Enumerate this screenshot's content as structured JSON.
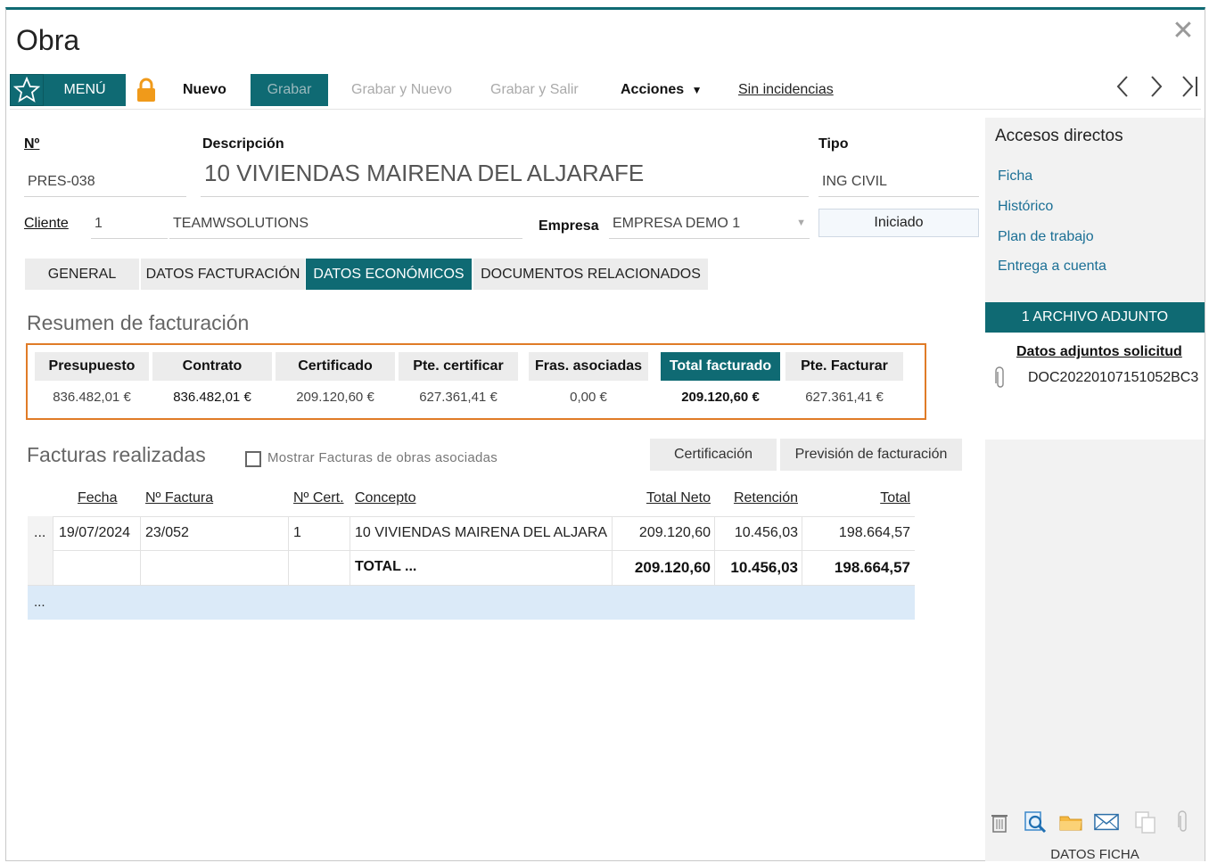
{
  "window": {
    "title": "Obra",
    "close_symbol": "✕"
  },
  "toolbar": {
    "menu_label": "MENÚ",
    "nuevo_label": "Nuevo",
    "grabar_label": "Grabar",
    "grabar_nuevo_label": "Grabar y Nuevo",
    "grabar_salir_label": "Grabar y Salir",
    "acciones_label": "Acciones",
    "incidencias_label": "Sin incidencias",
    "accent": "#0f6a73",
    "lock_color": "#f09a1a"
  },
  "header": {
    "numero_label": "Nº",
    "numero_value": "PRES-038",
    "descripcion_label": "Descripción",
    "descripcion_value": "10 VIVIENDAS MAIRENA DEL ALJARAFE",
    "tipo_label": "Tipo",
    "tipo_value": "ING CIVIL",
    "cliente_label": "Cliente",
    "cliente_code": "1",
    "cliente_name": "TEAMWSOLUTIONS",
    "empresa_label": "Empresa",
    "empresa_value": "EMPRESA DEMO 1",
    "estado_value": "Iniciado"
  },
  "tabs": [
    {
      "label": "GENERAL"
    },
    {
      "label": "DATOS FACTURACIÓN"
    },
    {
      "label": "DATOS ECONÓMICOS",
      "active": true
    },
    {
      "label": "DOCUMENTOS RELACIONADOS"
    }
  ],
  "resumen": {
    "title": "Resumen de facturación",
    "columns": [
      {
        "header": "Presupuesto",
        "value": "836.482,01 €"
      },
      {
        "header": "Contrato",
        "value": "836.482,01 €"
      },
      {
        "header": "Certificado",
        "value": "209.120,60 €"
      },
      {
        "header": "Pte. certificar",
        "value": "627.361,41 €"
      },
      {
        "header": "Fras. asociadas",
        "value": "0,00 €"
      },
      {
        "header": "Total facturado",
        "value": "209.120,60 €",
        "highlight": true
      },
      {
        "header": "Pte. Facturar",
        "value": "627.361,41 €"
      }
    ],
    "box_color": "#e07b27"
  },
  "facturas": {
    "title": "Facturas realizadas",
    "checkbox_label": "Mostrar Facturas de obras asociadas",
    "certificacion_label": "Certificación",
    "prevision_label": "Previsión de facturación",
    "columns": [
      "Fecha",
      "Nº Factura",
      "Nº Cert.",
      "Concepto",
      "Total Neto",
      "Retención",
      "Total"
    ],
    "rows": [
      {
        "marker": "...",
        "fecha": "19/07/2024",
        "factura": "23/052",
        "cert": "1",
        "concepto": "10 VIVIENDAS MAIRENA DEL ALJARA",
        "neto": "209.120,60",
        "retencion": "10.456,03",
        "total": "198.664,57"
      }
    ],
    "totals": {
      "label": "TOTAL ...",
      "neto": "209.120,60",
      "retencion": "10.456,03",
      "total": "198.664,57"
    },
    "new_row_marker": "...",
    "new_row_color": "#dbeaf8"
  },
  "sidebar": {
    "title": "Accesos directos",
    "links": [
      "Ficha",
      "Histórico",
      "Plan de trabajo",
      "Entrega a cuenta"
    ],
    "adjuntos_label": "1 ARCHIVO ADJUNTO",
    "adjuntos_title": "Datos adjuntos solicitud",
    "adjunto_file": "DOC20220107151052BC3",
    "datos_ficha_label": "DATOS FICHA",
    "icons": [
      "trash-icon",
      "search-document-icon",
      "folder-icon",
      "mail-icon",
      "copy-icon",
      "paperclip-icon"
    ]
  }
}
